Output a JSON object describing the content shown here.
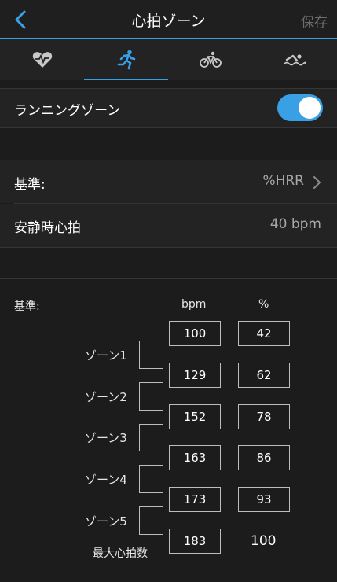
{
  "header": {
    "title": "心拍ゾーン",
    "save_label": "保存"
  },
  "tabs": [
    {
      "name": "heart-rate",
      "icon": "heart-pulse-icon"
    },
    {
      "name": "running",
      "icon": "runner-icon",
      "active": true
    },
    {
      "name": "cycling",
      "icon": "bicycle-icon"
    },
    {
      "name": "swimming",
      "icon": "swimmer-icon"
    }
  ],
  "settings": {
    "running_zone_label": "ランニングゾーン",
    "running_zone_enabled": true,
    "basis_label": "基準:",
    "basis_value": "%HRR",
    "resting_hr_label": "安静時心拍",
    "resting_hr_value": "40 bpm"
  },
  "zones": {
    "basis_label": "基準:",
    "bpm_header": "bpm",
    "pct_header": "%",
    "bpm_values": [
      "100",
      "129",
      "152",
      "163",
      "173",
      "183"
    ],
    "pct_values": [
      "42",
      "62",
      "78",
      "86",
      "93",
      "100"
    ],
    "zone_names": [
      "ゾーン1",
      "ゾーン2",
      "ゾーン3",
      "ゾーン4",
      "ゾーン5"
    ],
    "max_hr_label": "最大心拍数"
  },
  "colors": {
    "accent": "#3aa0e6",
    "background": "#1c1c1c",
    "row_background": "#232323"
  }
}
